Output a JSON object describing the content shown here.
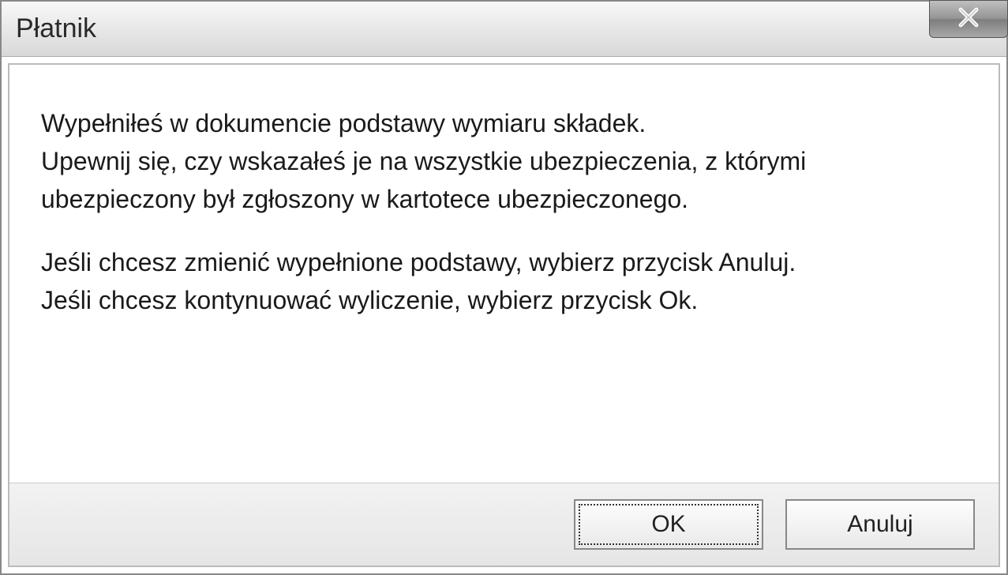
{
  "title": "Płatnik",
  "message": {
    "line1": "Wypełniłeś w dokumencie podstawy wymiaru składek.",
    "line2": "Upewnij się, czy wskazałeś je na wszystkie ubezpieczenia, z którymi",
    "line3": "ubezpieczony był zgłoszony w kartotece ubezpieczonego.",
    "line4": "Jeśli chcesz zmienić wypełnione podstawy, wybierz przycisk Anuluj.",
    "line5": "Jeśli chcesz kontynuować wyliczenie, wybierz przycisk Ok."
  },
  "buttons": {
    "ok": "OK",
    "cancel": "Anuluj"
  }
}
